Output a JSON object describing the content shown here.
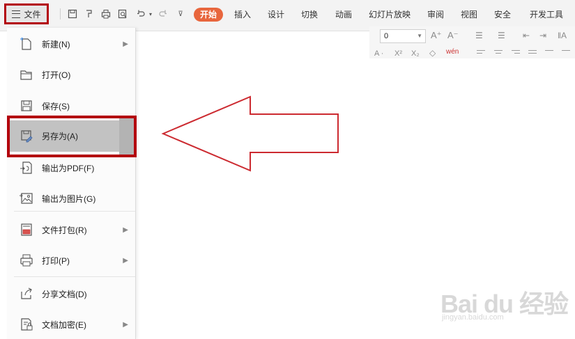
{
  "file_button": {
    "label": "文件"
  },
  "tabs": [
    {
      "label": "开始",
      "active": true
    },
    {
      "label": "插入"
    },
    {
      "label": "设计"
    },
    {
      "label": "切换"
    },
    {
      "label": "动画"
    },
    {
      "label": "幻灯片放映"
    },
    {
      "label": "审阅"
    },
    {
      "label": "视图"
    },
    {
      "label": "安全"
    },
    {
      "label": "开发工具"
    }
  ],
  "ribbon": {
    "font_size_value": "0"
  },
  "menu": {
    "items": [
      {
        "label": "新建(N)",
        "has_submenu": true,
        "icon": "new-document-icon"
      },
      {
        "label": "打开(O)",
        "has_submenu": false,
        "icon": "folder-open-icon"
      },
      {
        "label": "保存(S)",
        "has_submenu": false,
        "icon": "save-icon"
      },
      {
        "label": "另存为(A)",
        "has_submenu": true,
        "icon": "save-as-icon",
        "highlighted": true
      },
      {
        "label": "输出为PDF(F)",
        "has_submenu": false,
        "icon": "pdf-export-icon"
      },
      {
        "label": "输出为图片(G)",
        "has_submenu": false,
        "icon": "image-export-icon"
      },
      {
        "label": "文件打包(R)",
        "has_submenu": true,
        "icon": "package-icon"
      },
      {
        "label": "打印(P)",
        "has_submenu": true,
        "icon": "print-icon"
      },
      {
        "label": "分享文档(D)",
        "has_submenu": false,
        "icon": "share-icon"
      },
      {
        "label": "文档加密(E)",
        "has_submenu": true,
        "icon": "encrypt-icon"
      }
    ]
  },
  "watermark": {
    "logo": "Bai du 经验",
    "sub": "jingyan.baidu.com"
  },
  "colors": {
    "highlight_border": "#b3000c",
    "active_tab": "#e8663d",
    "menu_highlight": "#c2c2c2",
    "arrow_stroke": "#cc2a30"
  }
}
